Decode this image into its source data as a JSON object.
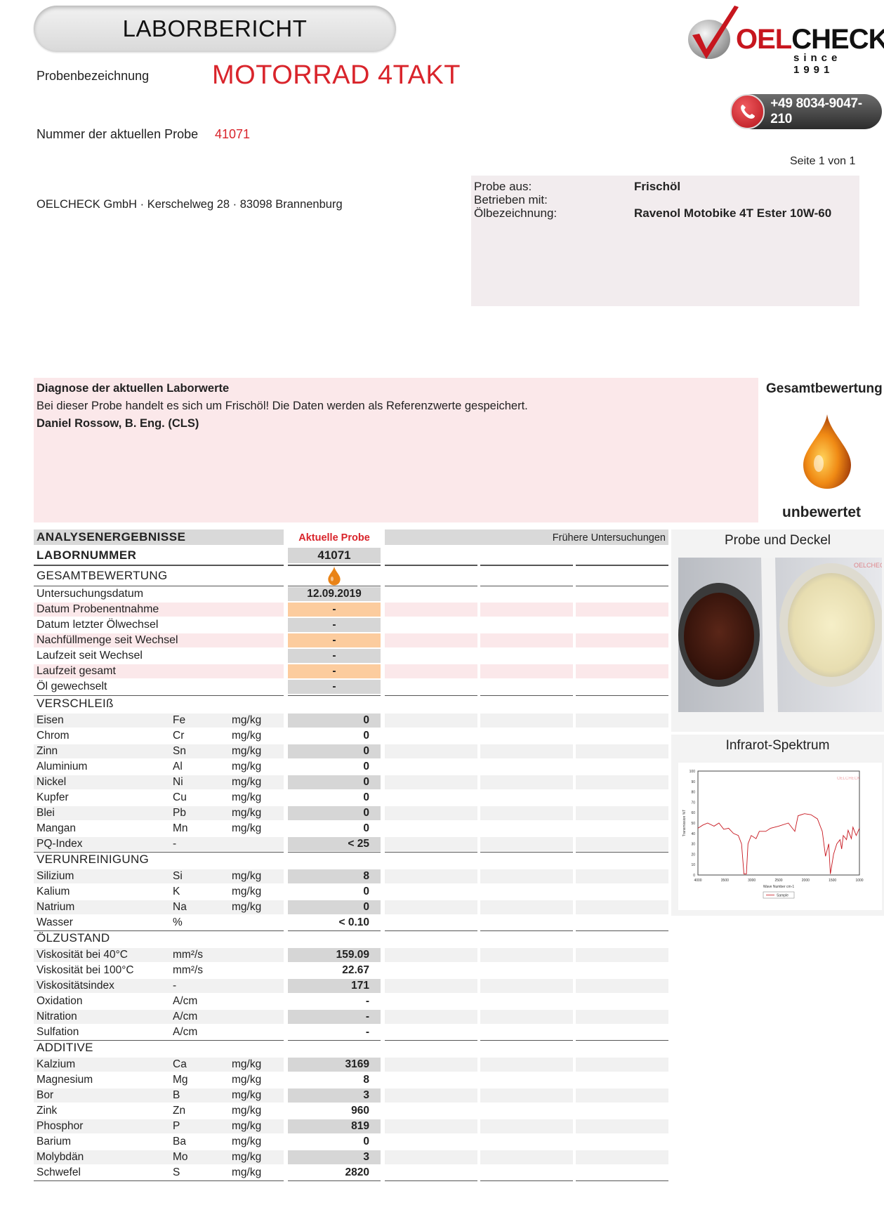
{
  "header": {
    "title": "LABORBERICHT",
    "sample_label": "Probenbezeichnung",
    "sample_name": "MOTORRAD 4TAKT",
    "sample_number_label": "Nummer der aktuellen Probe",
    "sample_number": "41071",
    "page": "Seite 1 von 1",
    "address": "OELCHECK GmbH · Kerschelweg 28 · 83098 Brannenburg",
    "phone": "+49 8034-9047-210",
    "logo_main": "CHECK",
    "logo_prefix": "OEL",
    "logo_since": "since 1991"
  },
  "info": {
    "origin_label": "Probe aus:",
    "origin_value": "Frischöl",
    "operated_label": "Betrieben mit:",
    "operated_value": "",
    "oil_label": "Ölbezeichnung:",
    "oil_value": "Ravenol Motobike 4T Ester 10W-60"
  },
  "diagnosis": {
    "heading": "Diagnose der aktuellen Laborwerte",
    "text": "Bei dieser Probe handelt es sich um Frischöl!  Die Daten werden als Referenzwerte gespeichert.",
    "author": "Daniel Rossow, B. Eng. (CLS)"
  },
  "overall": {
    "heading": "Gesamtbewertung",
    "rating": "unbewertet"
  },
  "table": {
    "heading": "ANALYSENERGEBNISSE",
    "current_label": "Aktuelle Probe",
    "previous_label": "Frühere Untersuchungen",
    "lab_label": "LABORNUMMER",
    "lab_value": "41071",
    "rating_label": "GESAMTBEWERTUNG",
    "general": [
      {
        "name": "Untersuchungsdatum",
        "value": "12.09.2019"
      },
      {
        "name": "Datum Probenentnahme",
        "value": "-"
      },
      {
        "name": "Datum letzter Ölwechsel",
        "value": "-"
      },
      {
        "name": "Nachfüllmenge seit Wechsel",
        "value": "-"
      },
      {
        "name": "Laufzeit seit Wechsel",
        "value": "-"
      },
      {
        "name": "Laufzeit gesamt",
        "value": "-"
      },
      {
        "name": "Öl gewechselt",
        "value": "-"
      }
    ],
    "sections": [
      {
        "title": "VERSCHLEIß",
        "rows": [
          {
            "name": "Eisen",
            "sym": "Fe",
            "unit": "mg/kg",
            "value": "0"
          },
          {
            "name": "Chrom",
            "sym": "Cr",
            "unit": "mg/kg",
            "value": "0"
          },
          {
            "name": "Zinn",
            "sym": "Sn",
            "unit": "mg/kg",
            "value": "0"
          },
          {
            "name": "Aluminium",
            "sym": "Al",
            "unit": "mg/kg",
            "value": "0"
          },
          {
            "name": "Nickel",
            "sym": "Ni",
            "unit": "mg/kg",
            "value": "0"
          },
          {
            "name": "Kupfer",
            "sym": "Cu",
            "unit": "mg/kg",
            "value": "0"
          },
          {
            "name": "Blei",
            "sym": "Pb",
            "unit": "mg/kg",
            "value": "0"
          },
          {
            "name": "Mangan",
            "sym": "Mn",
            "unit": "mg/kg",
            "value": "0"
          },
          {
            "name": "PQ-Index",
            "sym": "-",
            "unit": "",
            "value": "< 25"
          }
        ]
      },
      {
        "title": "VERUNREINIGUNG",
        "rows": [
          {
            "name": "Silizium",
            "sym": "Si",
            "unit": "mg/kg",
            "value": "8"
          },
          {
            "name": "Kalium",
            "sym": "K",
            "unit": "mg/kg",
            "value": "0"
          },
          {
            "name": "Natrium",
            "sym": "Na",
            "unit": "mg/kg",
            "value": "0"
          },
          {
            "name": "Wasser",
            "sym": "%",
            "unit": "",
            "value": "< 0.10"
          }
        ]
      },
      {
        "title": "ÖLZUSTAND",
        "rows": [
          {
            "name": "Viskosität bei 40°C",
            "sym": "mm²/s",
            "unit": "",
            "value": "159.09"
          },
          {
            "name": "Viskosität bei 100°C",
            "sym": "mm²/s",
            "unit": "",
            "value": "22.67"
          },
          {
            "name": "Viskositätsindex",
            "sym": "-",
            "unit": "",
            "value": "171"
          },
          {
            "name": "Oxidation",
            "sym": "A/cm",
            "unit": "",
            "value": "-"
          },
          {
            "name": "Nitration",
            "sym": "A/cm",
            "unit": "",
            "value": "-"
          },
          {
            "name": "Sulfation",
            "sym": "A/cm",
            "unit": "",
            "value": "-"
          }
        ]
      },
      {
        "title": "ADDITIVE",
        "rows": [
          {
            "name": "Kalzium",
            "sym": "Ca",
            "unit": "mg/kg",
            "value": "3169"
          },
          {
            "name": "Magnesium",
            "sym": "Mg",
            "unit": "mg/kg",
            "value": "8"
          },
          {
            "name": "Bor",
            "sym": "B",
            "unit": "mg/kg",
            "value": "3"
          },
          {
            "name": "Zink",
            "sym": "Zn",
            "unit": "mg/kg",
            "value": "960"
          },
          {
            "name": "Phosphor",
            "sym": "P",
            "unit": "mg/kg",
            "value": "819"
          },
          {
            "name": "Barium",
            "sym": "Ba",
            "unit": "mg/kg",
            "value": "0"
          },
          {
            "name": "Molybdän",
            "sym": "Mo",
            "unit": "mg/kg",
            "value": "3"
          },
          {
            "name": "Schwefel",
            "sym": "S",
            "unit": "mg/kg",
            "value": "2820"
          }
        ]
      }
    ]
  },
  "photo_panel": {
    "title": "Probe und Deckel",
    "watermark": "OELCHECK"
  },
  "ir_panel": {
    "title": "Infrarot-Spektrum",
    "ylabel": "Transmission %T",
    "xlabel": "Wave Number cm-1",
    "legend": "Sample",
    "watermark": "OELCHECK",
    "yticks": [
      "100",
      "90",
      "80",
      "70",
      "60",
      "50",
      "40",
      "30",
      "20",
      "10",
      "0"
    ],
    "xticks": [
      "4000",
      "3500",
      "3000",
      "2500",
      "2000",
      "1500",
      "1000"
    ]
  },
  "colors": {
    "brand_red": "#d9242b",
    "diag_bg": "#fbe8ea",
    "info_bg": "#f2ecee",
    "orange_cell": "#fccc9e",
    "gray_cell": "#d6d6d6"
  }
}
